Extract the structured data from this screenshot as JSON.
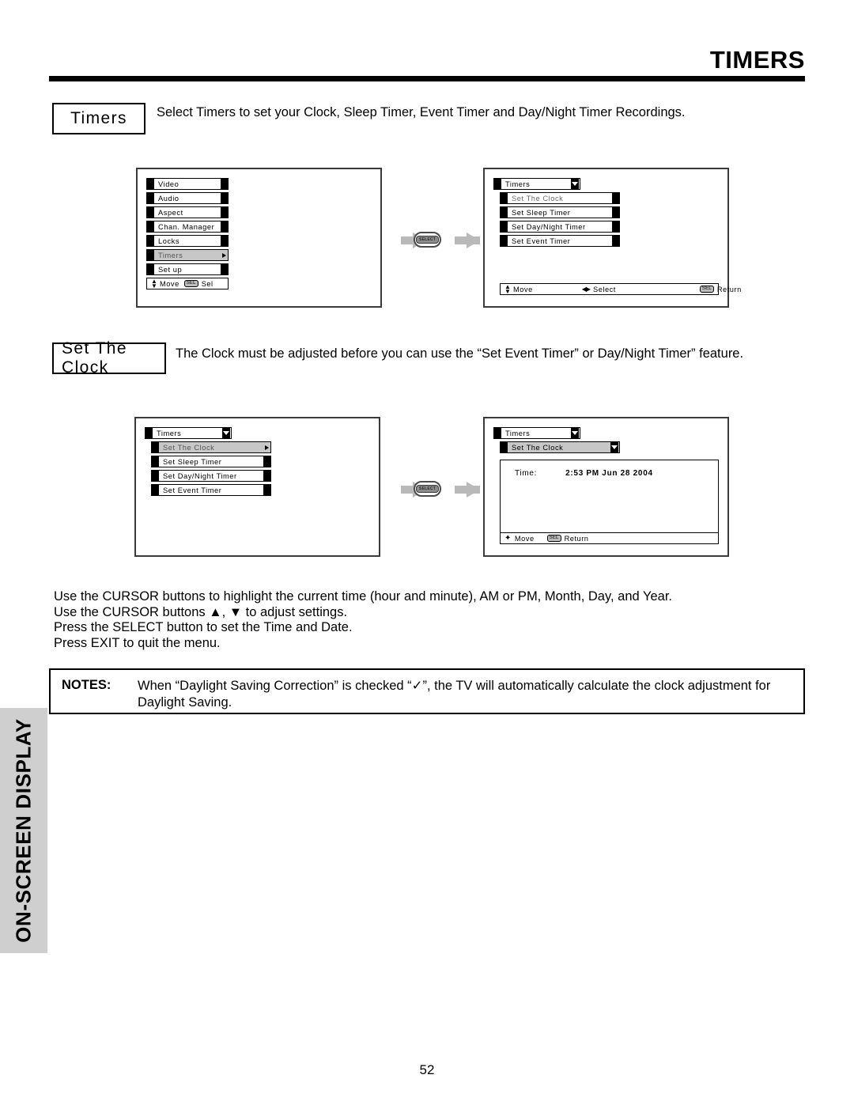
{
  "page": {
    "title": "TIMERS",
    "number": "52",
    "side_tab": "ON-SCREEN DISPLAY"
  },
  "sections": [
    {
      "label": "Timers",
      "description": "Select Timers to set your Clock, Sleep Timer, Event Timer and Day/Night Timer Recordings."
    },
    {
      "label": "Set The Clock",
      "description": "The Clock must be adjusted before you can use the “Set Event Timer” or Day/Night Timer” feature."
    }
  ],
  "osd": {
    "main_menu": {
      "items": [
        {
          "label": "Video",
          "selected": false
        },
        {
          "label": "Audio",
          "selected": false
        },
        {
          "label": "Aspect",
          "selected": false
        },
        {
          "label": "Chan. Manager",
          "selected": false
        },
        {
          "label": "Locks",
          "selected": false
        },
        {
          "label": "Timers",
          "selected": true
        },
        {
          "label": "Set up",
          "selected": false
        }
      ],
      "help": {
        "move": "Move",
        "select_chip": "SEL",
        "select": "Sel"
      }
    },
    "timers_menu": {
      "title": "Timers",
      "items": [
        {
          "label": "Set The Clock",
          "selected": false,
          "dimmed": true
        },
        {
          "label": "Set Sleep Timer",
          "selected": false
        },
        {
          "label": "Set Day/Night Timer",
          "selected": false
        },
        {
          "label": "Set Event Timer",
          "selected": false
        }
      ],
      "help": {
        "move": "Move",
        "select": "Select",
        "chip": "SEL",
        "return": "Return"
      }
    },
    "timers_menu_clock_highlighted": {
      "title": "Timers",
      "items": [
        {
          "label": "Set The Clock",
          "selected": true
        },
        {
          "label": "Set Sleep Timer",
          "selected": false
        },
        {
          "label": "Set Day/Night Timer",
          "selected": false
        },
        {
          "label": "Set Event Timer",
          "selected": false
        }
      ]
    },
    "set_clock_screen": {
      "title": "Timers",
      "subtitle": "Set The Clock",
      "time_label": "Time:",
      "time_value": "2:53 PM Jun 28 2004",
      "help": {
        "move": "Move",
        "chip": "SEL",
        "return": "Return"
      }
    }
  },
  "instructions": [
    "Use the CURSOR buttons to highlight the current time (hour and minute), AM or PM, Month, Day, and Year.",
    "Use the CURSOR buttons ▲, ▼ to adjust settings.",
    "Press the SELECT button to set the Time and Date.",
    "Press EXIT to quit the menu."
  ],
  "notes": {
    "label": "NOTES:",
    "body": "When “Daylight Saving Correction” is checked “✓”, the TV will automatically calculate the clock adjustment for Daylight Saving."
  },
  "flow": {
    "select_button_label": "SELECT"
  },
  "colors": {
    "rule": "#000000",
    "side_tab_bg": "#cfcfcf",
    "highlight": "#c7c7c7",
    "arrow": "#b9b9b9"
  }
}
